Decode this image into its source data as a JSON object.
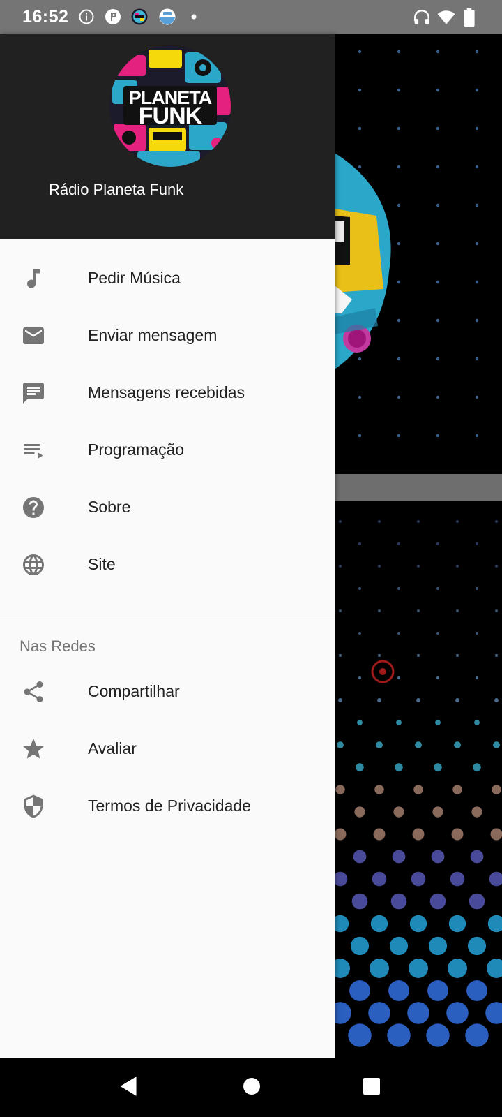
{
  "status_bar": {
    "time": "16:52",
    "left_icons": [
      "info-icon",
      "app-p-icon",
      "planeta-funk-notification-icon",
      "test-notification-icon",
      "dot-icon"
    ],
    "right_icons": [
      "headphones-icon",
      "wifi-icon",
      "battery-icon"
    ]
  },
  "drawer": {
    "header": {
      "logo_text_line1": "PLANETA",
      "logo_text_line2": "FUNK",
      "title": "Rádio Planeta Funk"
    },
    "items": [
      {
        "label": "Pedir Música",
        "icon": "music-note-icon"
      },
      {
        "label": "Enviar mensagem",
        "icon": "mail-icon"
      },
      {
        "label": "Mensagens recebidas",
        "icon": "chat-message-icon"
      },
      {
        "label": "Programação",
        "icon": "playlist-icon"
      },
      {
        "label": "Sobre",
        "icon": "help-circle-icon"
      },
      {
        "label": "Site",
        "icon": "globe-icon"
      }
    ],
    "section_title": "Nas Redes",
    "social_items": [
      {
        "label": "Compartilhar",
        "icon": "share-icon"
      },
      {
        "label": "Avaliar",
        "icon": "star-icon"
      },
      {
        "label": "Termos de Privacidade",
        "icon": "shield-icon"
      }
    ]
  },
  "nav_bar": [
    "back-icon",
    "home-icon",
    "recents-icon"
  ],
  "colors": {
    "status_bar": "#757575",
    "drawer_header": "#212121",
    "drawer_bg": "#fafafa",
    "icon_gray": "#757575",
    "text_primary": "#212121",
    "text_secondary": "#757575"
  }
}
